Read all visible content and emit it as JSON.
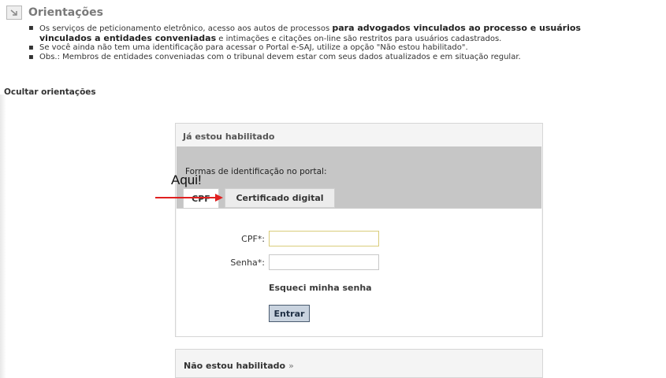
{
  "orientacoes": {
    "title": "Orientações",
    "icon": "arrow-icon",
    "items": [
      {
        "line1_normal": "Os serviços de peticionamento eletrônico, acesso aos autos de processos ",
        "line1_bold": "para advogados vinculados ao processo e usuários",
        "line2_bold": "vinculados a entidades conveniadas",
        "line2_normal": " e intimações e citações on-line são restritos para usuários cadastrados."
      },
      {
        "text": "Se você ainda não tem uma identificação para acessar o Portal e-SAJ, utilize a opção \"Não estou habilitado\"."
      },
      {
        "text": "Obs.: Membros de entidades conveniadas com o tribunal devem estar com seus dados atualizados e em situação regular."
      }
    ],
    "hide_link": "Ocultar orientações"
  },
  "login_box": {
    "title": "Já estou habilitado",
    "identification_label": "Formas de identificação no portal:",
    "tabs": [
      {
        "label": "CPF",
        "active": true
      },
      {
        "label": "Certificado digital",
        "active": false
      }
    ],
    "cpf_label": "CPF*:",
    "cpf_value": "",
    "password_label": "Senha*:",
    "password_value": "",
    "forgot_link": "Esqueci minha senha",
    "submit_label": "Entrar"
  },
  "not_enabled": {
    "title": "Não estou habilitado",
    "chevron": "»"
  },
  "annotation": {
    "text": "Aqui!",
    "arrow_color": "#e02020"
  }
}
